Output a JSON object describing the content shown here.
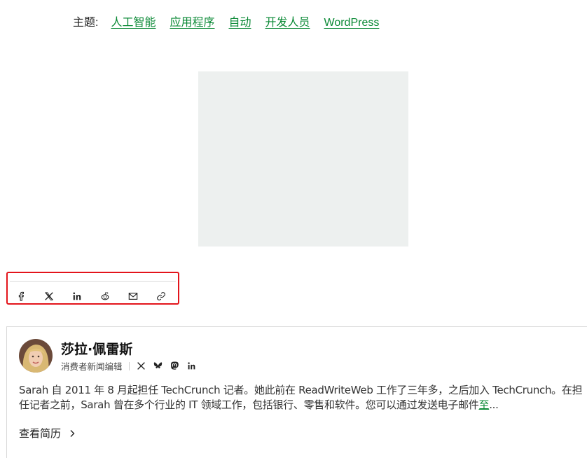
{
  "topics": {
    "label": "主题:",
    "items": [
      "人工智能",
      "应用程序",
      "自动",
      "开发人员",
      "WordPress"
    ]
  },
  "share": {
    "icons": [
      "facebook-icon",
      "x-icon",
      "linkedin-icon",
      "reddit-icon",
      "email-icon",
      "link-icon"
    ]
  },
  "author": {
    "name": "莎拉·佩雷斯",
    "role": "消费者新闻编辑",
    "social_icons": [
      "x-icon",
      "bluesky-icon",
      "mastodon-icon",
      "linkedin-icon"
    ],
    "bio_text": "Sarah 自 2011 年 8 月起担任 TechCrunch 记者。她此前在 ReadWriteWeb 工作了三年多，之后加入 TechCrunch。在担任记者之前，Sarah 曾在多个行业的 IT 领域工作，包括银行、零售和软件。您可以通过发送电子邮件",
    "bio_link": "至",
    "bio_ellipsis": "...",
    "view_bio_label": "查看简历"
  },
  "colors": {
    "link_green": "#0a8935",
    "highlight_red": "#e3141b",
    "placeholder_gray": "#edf0ef"
  }
}
